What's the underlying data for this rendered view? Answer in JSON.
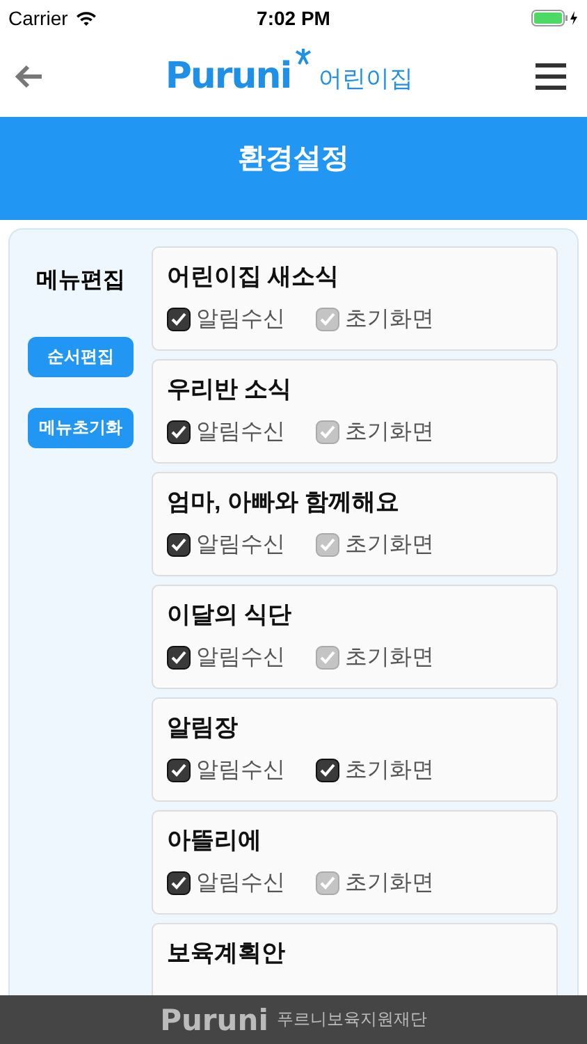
{
  "status_bar": {
    "carrier": "Carrier",
    "time": "7:02 PM"
  },
  "header": {
    "logo": "Puruni",
    "subtitle": "어린이집"
  },
  "banner": {
    "title": "환경설정"
  },
  "sidebar": {
    "title": "메뉴편집",
    "buttons": [
      "순서편집",
      "메뉴초기화"
    ]
  },
  "menus": [
    {
      "title": "어린이집 새소식",
      "options": [
        {
          "label": "알림수신",
          "checked": true
        },
        {
          "label": "초기화면",
          "checked": false
        }
      ]
    },
    {
      "title": "우리반 소식",
      "options": [
        {
          "label": "알림수신",
          "checked": true
        },
        {
          "label": "초기화면",
          "checked": false
        }
      ]
    },
    {
      "title": "엄마, 아빠와 함께해요",
      "options": [
        {
          "label": "알림수신",
          "checked": true
        },
        {
          "label": "초기화면",
          "checked": false
        }
      ]
    },
    {
      "title": "이달의 식단",
      "options": [
        {
          "label": "알림수신",
          "checked": true
        },
        {
          "label": "초기화면",
          "checked": false
        }
      ]
    },
    {
      "title": "알림장",
      "options": [
        {
          "label": "알림수신",
          "checked": true
        },
        {
          "label": "초기화면",
          "checked": true
        }
      ]
    },
    {
      "title": "아뜰리에",
      "options": [
        {
          "label": "알림수신",
          "checked": true
        },
        {
          "label": "초기화면",
          "checked": false
        }
      ]
    },
    {
      "title": "보육계획안"
    }
  ],
  "footer": {
    "logo": "Puruni",
    "text": "푸르니보육지원재단"
  }
}
